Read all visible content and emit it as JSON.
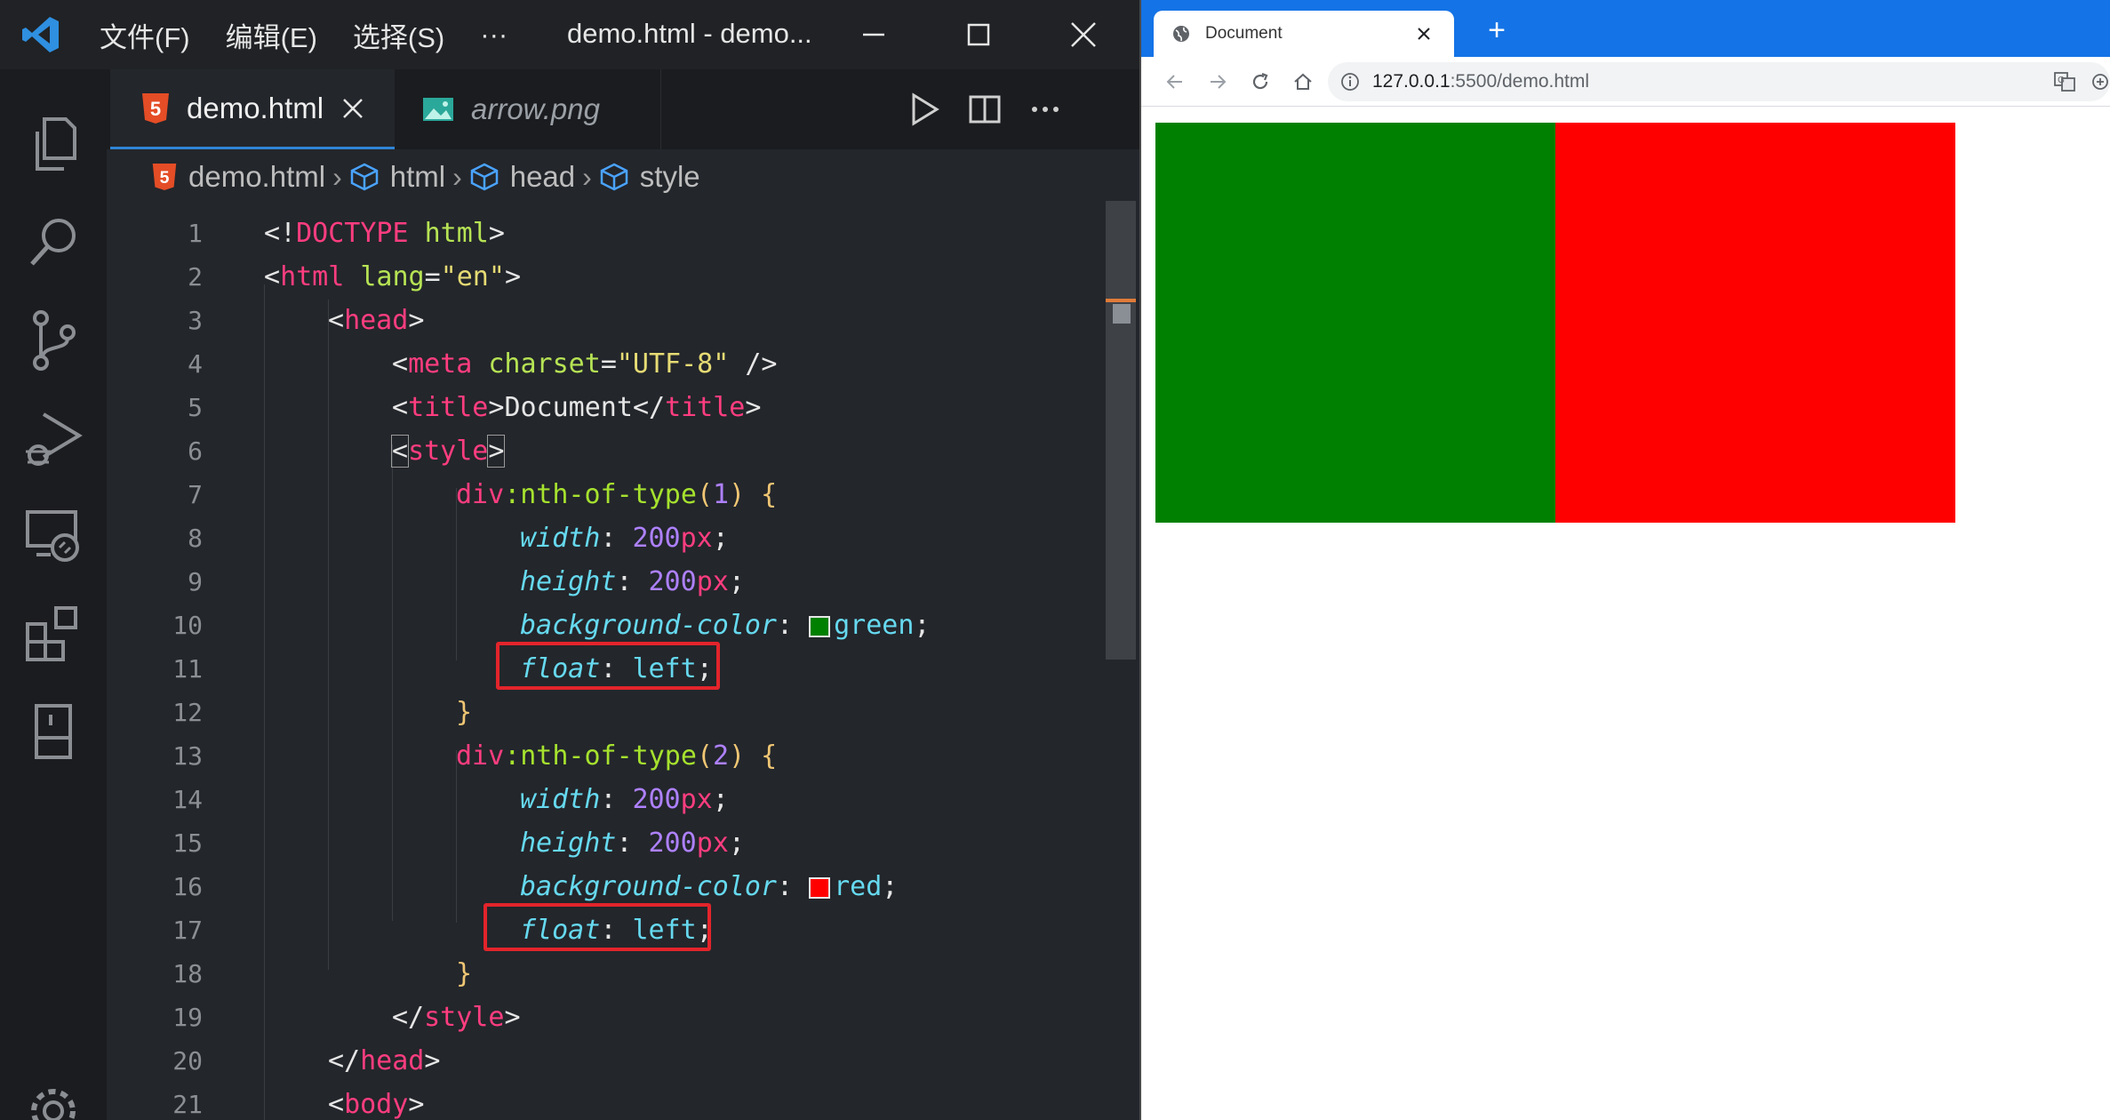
{
  "vscode": {
    "menu": [
      "文件(F)",
      "编辑(E)",
      "选择(S)",
      "···"
    ],
    "window_title": "demo.html - demo...",
    "tabs": [
      {
        "label": "demo.html",
        "active": true
      },
      {
        "label": "arrow.png",
        "active": false
      }
    ],
    "breadcrumb": [
      "demo.html",
      "html",
      "head",
      "style"
    ],
    "line_numbers": [
      "1",
      "2",
      "3",
      "4",
      "5",
      "6",
      "7",
      "8",
      "9",
      "10",
      "11",
      "12",
      "13",
      "14",
      "15",
      "16",
      "17",
      "18",
      "19",
      "20",
      "21"
    ],
    "code": {
      "l1_lt": "<!",
      "l1_doctype": "DOCTYPE",
      "l1_html": " html",
      "l1_gt": ">",
      "l2_lt": "<",
      "l2_tag": "html",
      "l2_attr": " lang",
      "l2_eq": "=",
      "l2_str": "\"en\"",
      "l2_gt": ">",
      "l3_lt": "<",
      "l3_tag": "head",
      "l3_gt": ">",
      "l4_lt": "<",
      "l4_tag": "meta",
      "l4_attr": " charset",
      "l4_eq": "=",
      "l4_str": "\"UTF-8\"",
      "l4_end": " />",
      "l5_lt": "<",
      "l5_tag": "title",
      "l5_gt": ">",
      "l5_text": "Document",
      "l5_close_lt": "</",
      "l5_close_tag": "title",
      "l5_close_gt": ">",
      "l6_lt": "<",
      "l6_tag": "style",
      "l6_gt": ">",
      "l7_sel": "div",
      "l7_pseudo": ":nth-of-type",
      "l7_paren_open": "(",
      "l7_num": "1",
      "l7_paren_close": ")",
      "l7_brace": " {",
      "l8_prop": "width",
      "l8_colon": ": ",
      "l8_num": "200",
      "l8_unit": "px",
      "l8_semi": ";",
      "l9_prop": "height",
      "l9_colon": ": ",
      "l9_num": "200",
      "l9_unit": "px",
      "l9_semi": ";",
      "l10_prop": "background-color",
      "l10_colon": ": ",
      "l10_val": "green",
      "l10_semi": ";",
      "l11_prop": "float",
      "l11_colon": ": ",
      "l11_val": "left",
      "l11_semi": ";",
      "l12_brace": "}",
      "l13_sel": "div",
      "l13_pseudo": ":nth-of-type",
      "l13_paren_open": "(",
      "l13_num": "2",
      "l13_paren_close": ")",
      "l13_brace": " {",
      "l14_prop": "width",
      "l14_colon": ": ",
      "l14_num": "200",
      "l14_unit": "px",
      "l14_semi": ";",
      "l15_prop": "height",
      "l15_colon": ": ",
      "l15_num": "200",
      "l15_unit": "px",
      "l15_semi": ";",
      "l16_prop": "background-color",
      "l16_colon": ": ",
      "l16_val": "red",
      "l16_semi": ";",
      "l17_prop": "float",
      "l17_colon": ": ",
      "l17_val": "left",
      "l17_semi": ";",
      "l18_brace": "}",
      "l19_lt": "</",
      "l19_tag": "style",
      "l19_gt": ">",
      "l20_lt": "</",
      "l20_tag": "head",
      "l20_gt": ">",
      "l21_lt": "<",
      "l21_tag": "body",
      "l21_gt": ">"
    },
    "colors": {
      "swatch_green": "#008000",
      "swatch_red": "#ff0000",
      "highlight_box": "#e3242b"
    }
  },
  "browser": {
    "tab_title": "Document",
    "new_tab": "+",
    "url_host": "127.0.0.1",
    "url_rest": ":5500/demo.html",
    "boxes": [
      {
        "color": "#008000"
      },
      {
        "color": "#ff0000"
      }
    ],
    "icons": [
      "back-icon",
      "forward-icon",
      "reload-icon",
      "home-icon",
      "info-icon",
      "translate-icon"
    ]
  }
}
